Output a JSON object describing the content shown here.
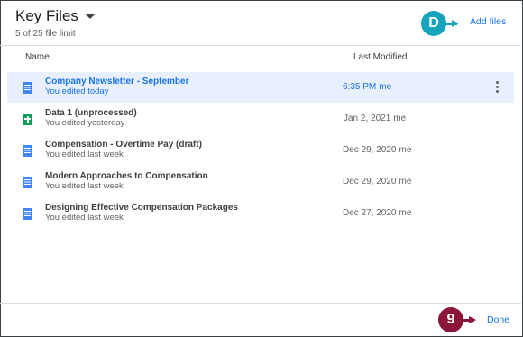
{
  "header": {
    "title": "Key Files",
    "subtitle": "5 of 25 file limit",
    "add_files_label": "Add files"
  },
  "columns": {
    "name": "Name",
    "last_modified": "Last Modified"
  },
  "files": [
    {
      "name": "Company Newsletter - September",
      "sub": "You edited today",
      "date": "6:35 PM",
      "owner": "me",
      "icon": "doc-icon",
      "selected": true
    },
    {
      "name": "Data 1 (unprocessed)",
      "sub": "You edited yesterday",
      "date": "Jan 2, 2021",
      "owner": "me",
      "icon": "sheet-icon",
      "selected": false
    },
    {
      "name": "Compensation - Overtime Pay (draft)",
      "sub": "You edited last week",
      "date": "Dec 29, 2020",
      "owner": "me",
      "icon": "doc-icon",
      "selected": false
    },
    {
      "name": "Modern Approaches to Compensation",
      "sub": "You edited last week",
      "date": "Dec 29, 2020",
      "owner": "me",
      "icon": "doc-icon",
      "selected": false
    },
    {
      "name": "Designing Effective Compensation Packages",
      "sub": "You edited last week",
      "date": "Dec 27, 2020",
      "owner": "me",
      "icon": "doc-icon",
      "selected": false
    }
  ],
  "footer": {
    "done_label": "Done"
  },
  "callouts": {
    "add_files": "D",
    "done": "9"
  },
  "colors": {
    "accent": "#1a73e8",
    "callout_teal": "#16a4bd",
    "callout_maroon": "#8b1538",
    "selected_row": "#e8f0fe"
  }
}
